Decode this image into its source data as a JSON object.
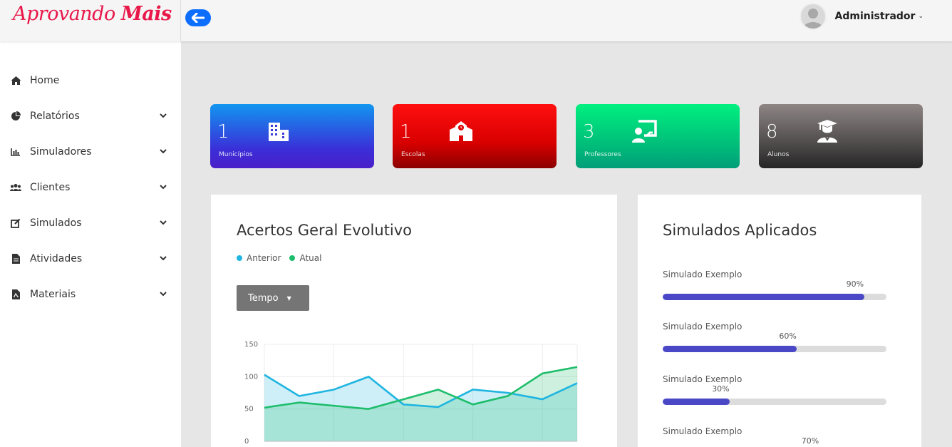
{
  "app": {
    "logo_part1": "Aprovando ",
    "logo_part2": "Mais"
  },
  "user": {
    "name": "Administrador"
  },
  "sidebar": {
    "items": [
      {
        "label": "Home"
      },
      {
        "label": "Relatórios"
      },
      {
        "label": "Simuladores"
      },
      {
        "label": "Clientes"
      },
      {
        "label": "Simulados"
      },
      {
        "label": "Atividades"
      },
      {
        "label": "Materiais"
      }
    ]
  },
  "stats": [
    {
      "value": "1",
      "label": "Municípios"
    },
    {
      "value": "1",
      "label": "Escolas"
    },
    {
      "value": "3",
      "label": "Professores"
    },
    {
      "value": "8",
      "label": "Alunos"
    }
  ],
  "chart_card": {
    "title": "Acertos Geral Evolutivo",
    "legend": [
      "Anterior",
      "Atual"
    ],
    "dropdown_label": "Tempo"
  },
  "simulados_card": {
    "title": "Simulados Aplicados",
    "items": [
      {
        "label": "Simulado Exemplo",
        "pct_text": "90%",
        "value": 90
      },
      {
        "label": "Simulado Exemplo",
        "pct_text": "60%",
        "value": 60
      },
      {
        "label": "Simulado Exemplo",
        "pct_text": "30%",
        "value": 30
      },
      {
        "label": "Simulado Exemplo",
        "pct_text": "70%",
        "value": 70
      }
    ]
  },
  "colors": {
    "progress": "#4b48c8",
    "anterior": "#1fb5e0",
    "atual": "#1dbd6b"
  },
  "chart_data": {
    "type": "area",
    "x": [
      0,
      1,
      2,
      3,
      4,
      5,
      6,
      7,
      8,
      9
    ],
    "ylim": [
      0,
      150
    ],
    "yticks": [
      "150",
      "100",
      "50",
      "0"
    ],
    "series": [
      {
        "name": "Anterior",
        "values": [
          103,
          70,
          80,
          100,
          57,
          53,
          80,
          75,
          65,
          90
        ]
      },
      {
        "name": "Atual",
        "values": [
          52,
          60,
          55,
          50,
          65,
          80,
          57,
          70,
          105,
          115
        ]
      }
    ]
  }
}
